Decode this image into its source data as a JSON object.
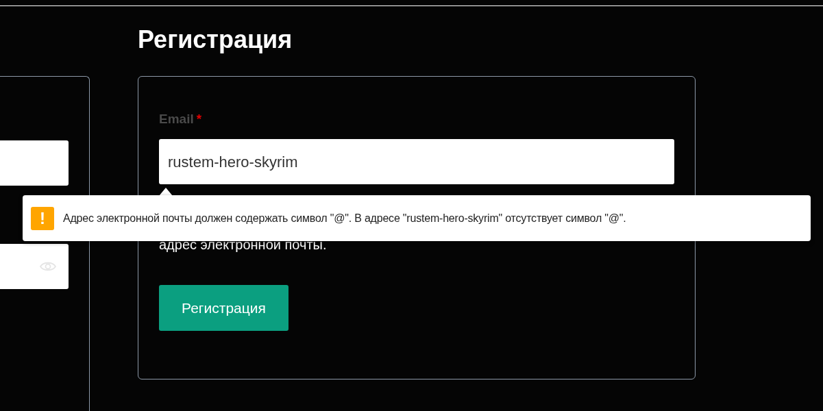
{
  "title": "Регистрация",
  "left_card": {
    "fields": [
      {
        "kind": "text"
      },
      {
        "kind": "password"
      }
    ]
  },
  "form": {
    "email_label": "Email",
    "required_mark": "*",
    "email_value": "rustem-hero-skyrim",
    "hint": "адрес электронной почты.",
    "submit": "Регистрация"
  },
  "tooltip": {
    "kind": "warning",
    "icon": "!",
    "message": "Адрес электронной почты должен содержать символ \"@\". В адресе \"rustem-hero-skyrim\" отсутствует символ \"@\"."
  }
}
